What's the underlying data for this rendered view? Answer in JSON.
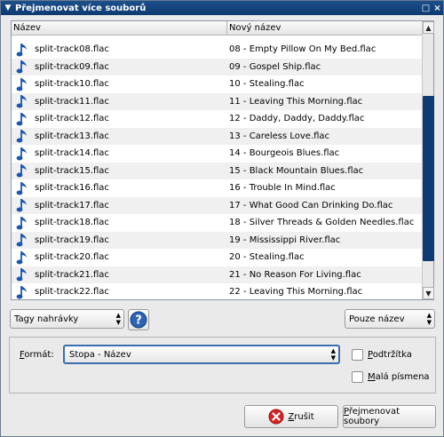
{
  "window": {
    "title": "Přejmenovat více souborů"
  },
  "list": {
    "columns": [
      "Název",
      "Nový název"
    ],
    "rows": [
      {
        "old": "split-track08.flac",
        "new": "08 - Empty Pillow On My Bed.flac"
      },
      {
        "old": "split-track09.flac",
        "new": "09 - Gospel Ship.flac"
      },
      {
        "old": "split-track10.flac",
        "new": "10 - Stealing.flac"
      },
      {
        "old": "split-track11.flac",
        "new": "11 - Leaving This Morning.flac"
      },
      {
        "old": "split-track12.flac",
        "new": "12 - Daddy, Daddy, Daddy.flac"
      },
      {
        "old": "split-track13.flac",
        "new": "13 - Careless Love.flac"
      },
      {
        "old": "split-track14.flac",
        "new": "14 - Bourgeois Blues.flac"
      },
      {
        "old": "split-track15.flac",
        "new": "15 - Black Mountain Blues.flac"
      },
      {
        "old": "split-track16.flac",
        "new": "16 - Trouble In Mind.flac"
      },
      {
        "old": "split-track17.flac",
        "new": "17 - What Good Can Drinking Do.flac"
      },
      {
        "old": "split-track18.flac",
        "new": "18 - Silver Threads & Golden Needles.flac"
      },
      {
        "old": "split-track19.flac",
        "new": "19 - Mississippi River.flac"
      },
      {
        "old": "split-track20.flac",
        "new": "20 - Stealing.flac"
      },
      {
        "old": "split-track21.flac",
        "new": "21 - No Reason For Living.flac"
      },
      {
        "old": "split-track22.flac",
        "new": "22 - Leaving This Morning.flac"
      }
    ],
    "row_icon": "music-note-icon"
  },
  "controls": {
    "tags_select": "Tagy nahrávky",
    "help_icon": "help-icon",
    "mode_select": "Pouze název"
  },
  "format": {
    "label_accel": "F",
    "label_rest": "ormát:",
    "value": "Stopa - Název",
    "underscores_accel": "P",
    "underscores_rest": "odtržítka",
    "lowercase_accel": "M",
    "lowercase_rest": "alá písmena"
  },
  "buttons": {
    "cancel_accel": "Z",
    "cancel_rest": "rušit",
    "rename_accel": "P",
    "rename_rest": "řejmenovat soubory"
  },
  "colors": {
    "titlebar": "#0d3a70",
    "scroll_thumb": "#0f3b73",
    "note_icon": "#1c55b0",
    "cancel_icon": "#d42424"
  }
}
